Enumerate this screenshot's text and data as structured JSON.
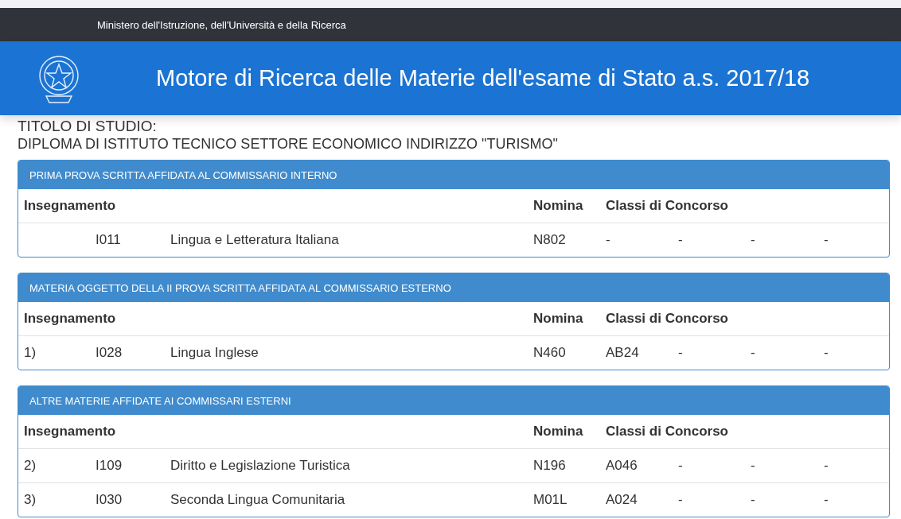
{
  "top_bar": {
    "ministry": "Ministero dell'Istruzione, dell'Università e della Ricerca"
  },
  "banner": {
    "title": "Motore di Ricerca delle Materie dell'esame di Stato a.s. 2017/18"
  },
  "degree": {
    "label": "TITOLO DI STUDIO:",
    "value": "DIPLOMA DI ISTITUTO TECNICO SETTORE ECONOMICO INDIRIZZO \"TURISMO\""
  },
  "panels": [
    {
      "title": "PRIMA PROVA SCRITTA AFFIDATA AL COMMISSARIO INTERNO",
      "columns": [
        "Insegnamento",
        "Nomina",
        "Classi di Concorso"
      ],
      "rows": [
        {
          "code": "I011",
          "subject": "Lingua e Letteratura Italiana",
          "nomina": "N802",
          "classes": [
            "-",
            "-",
            "-",
            "-"
          ]
        }
      ]
    },
    {
      "title": "MATERIA OGGETTO DELLA II PROVA SCRITTA AFFIDATA AL COMMISSARIO ESTERNO",
      "columns": [
        "Insegnamento",
        "Nomina",
        "Classi di Concorso"
      ],
      "rows": [
        {
          "number": "1)",
          "code": "I028",
          "subject": "Lingua Inglese",
          "nomina": "N460",
          "classes": [
            "AB24",
            "-",
            "-",
            "-"
          ]
        }
      ]
    },
    {
      "title": "ALTRE MATERIE AFFIDATE AI COMMISSARI ESTERNI",
      "columns": [
        "Insegnamento",
        "Nomina",
        "Classi di Concorso"
      ],
      "rows": [
        {
          "number": "2)",
          "code": "I109",
          "subject": "Diritto e Legislazione Turistica",
          "nomina": "N196",
          "classes": [
            "A046",
            "-",
            "-",
            "-"
          ]
        },
        {
          "number": "3)",
          "code": "I030",
          "subject": "Seconda Lingua Comunitaria",
          "nomina": "M01L",
          "classes": [
            "A024",
            "-",
            "-",
            "-"
          ]
        }
      ]
    }
  ]
}
